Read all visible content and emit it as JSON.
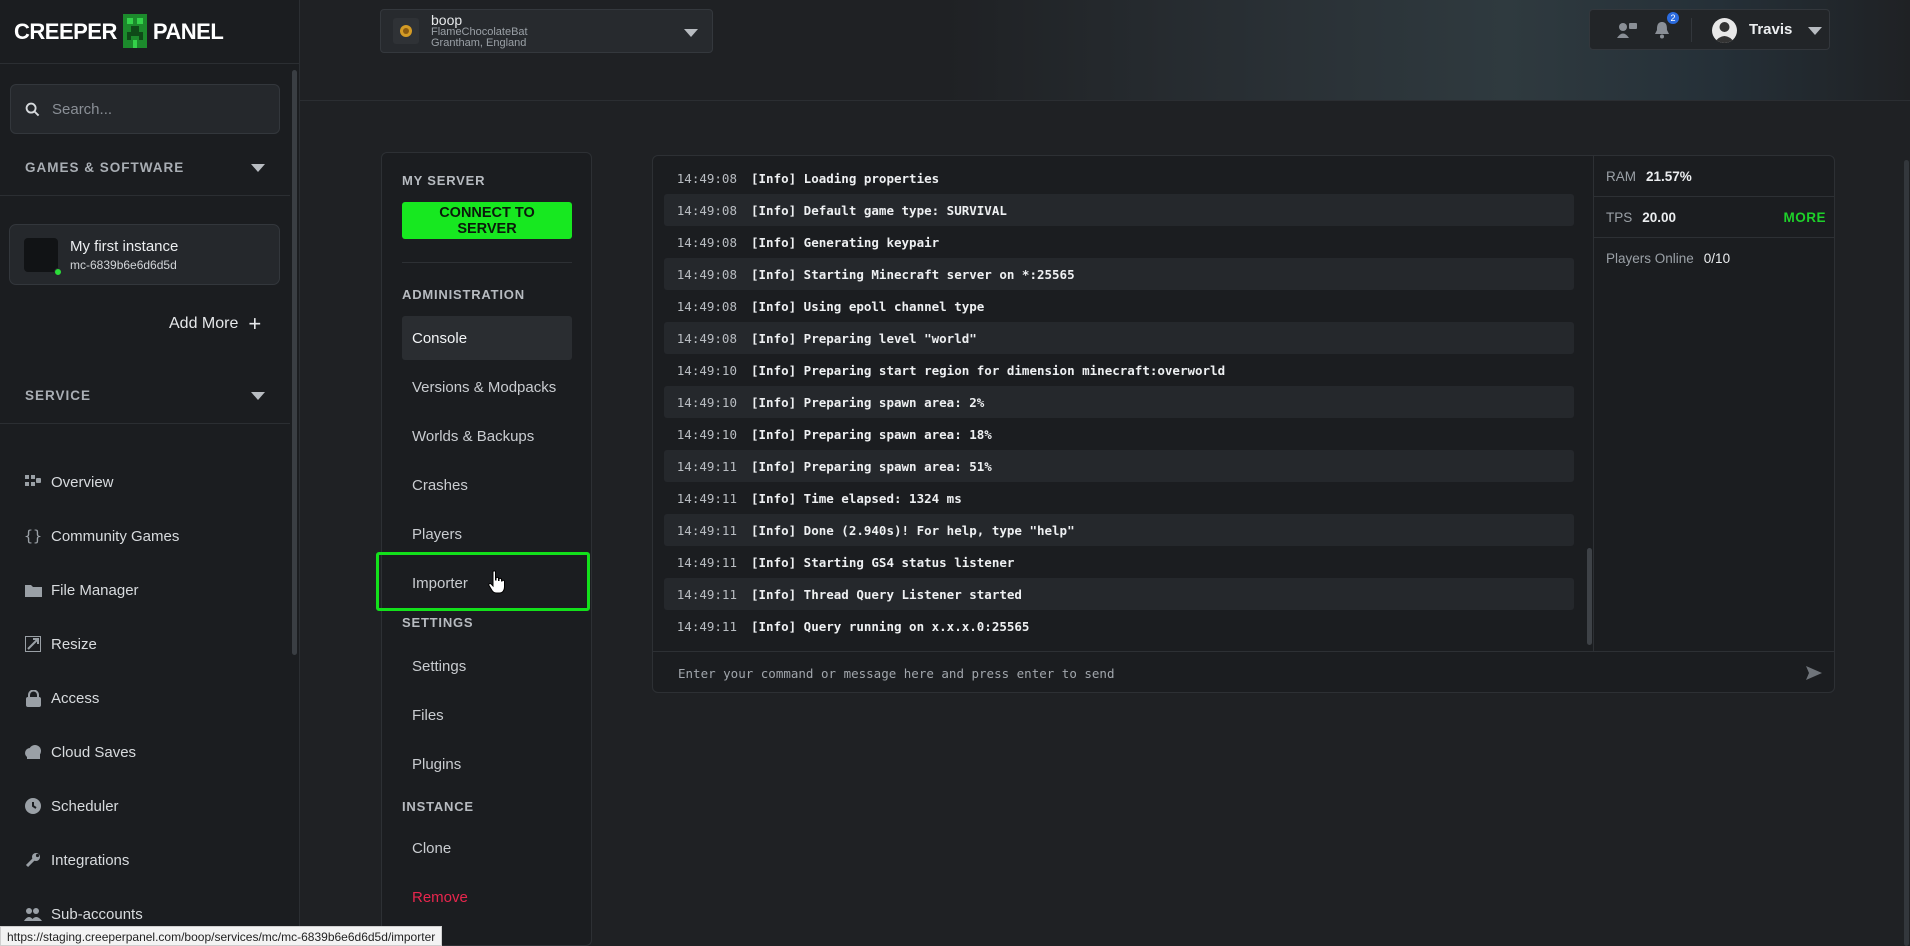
{
  "app": {
    "logo_left": "CREEPER",
    "logo_right": "PANEL",
    "search_placeholder": "Search..."
  },
  "sidebar": {
    "games_section": "GAMES & SOFTWARE",
    "instance": {
      "name": "My first instance",
      "id": "mc-6839b6e6d6d5d",
      "status": "online"
    },
    "add_more": "Add More",
    "service_section": "SERVICE",
    "items": [
      {
        "label": "Overview",
        "icon": "grid-icon"
      },
      {
        "label": "Community Games",
        "icon": "braces-icon"
      },
      {
        "label": "File Manager",
        "icon": "folder-icon"
      },
      {
        "label": "Resize",
        "icon": "resize-icon"
      },
      {
        "label": "Access",
        "icon": "lock-icon"
      },
      {
        "label": "Cloud Saves",
        "icon": "cloud-icon"
      },
      {
        "label": "Scheduler",
        "icon": "clock-icon"
      },
      {
        "label": "Integrations",
        "icon": "wrench-icon"
      },
      {
        "label": "Sub-accounts",
        "icon": "users-icon"
      }
    ]
  },
  "topbar": {
    "server_name": "boop",
    "server_user": "FlameChocolateBat",
    "server_location": "Grantham, England",
    "notifications_count": "2",
    "user_name": "Travis"
  },
  "menu": {
    "my_server": "MY SERVER",
    "connect": "CONNECT TO SERVER",
    "administration": "ADMINISTRATION",
    "admin_items": [
      "Console",
      "Versions & Modpacks",
      "Worlds & Backups",
      "Crashes",
      "Players",
      "Importer"
    ],
    "settings_section": "SETTINGS",
    "settings_items": [
      "Settings",
      "Files",
      "Plugins"
    ],
    "instance_section": "INSTANCE",
    "instance_items": [
      "Clone",
      "Remove"
    ],
    "active": "Console",
    "hovered": "Importer"
  },
  "console": {
    "log": [
      {
        "time": "14:49:08",
        "msg": "[Info] Loading properties"
      },
      {
        "time": "14:49:08",
        "msg": "[Info] Default game type: SURVIVAL"
      },
      {
        "time": "14:49:08",
        "msg": "[Info] Generating keypair"
      },
      {
        "time": "14:49:08",
        "msg": "[Info] Starting Minecraft server on *:25565"
      },
      {
        "time": "14:49:08",
        "msg": "[Info] Using epoll channel type"
      },
      {
        "time": "14:49:08",
        "msg": "[Info] Preparing level \"world\""
      },
      {
        "time": "14:49:10",
        "msg": "[Info] Preparing start region for dimension minecraft:overworld"
      },
      {
        "time": "14:49:10",
        "msg": "[Info] Preparing spawn area: 2%"
      },
      {
        "time": "14:49:10",
        "msg": "[Info] Preparing spawn area: 18%"
      },
      {
        "time": "14:49:11",
        "msg": "[Info] Preparing spawn area: 51%"
      },
      {
        "time": "14:49:11",
        "msg": "[Info] Time elapsed: 1324 ms"
      },
      {
        "time": "14:49:11",
        "msg": "[Info] Done (2.940s)! For help, type \"help\""
      },
      {
        "time": "14:49:11",
        "msg": "[Info] Starting GS4 status listener"
      },
      {
        "time": "14:49:11",
        "msg": "[Info] Thread Query Listener started"
      },
      {
        "time": "14:49:11",
        "msg": "[Info] Query running on x.x.x.0:25565"
      }
    ],
    "command_placeholder": "Enter your command or message here and press enter to send"
  },
  "stats": {
    "ram_label": "RAM",
    "ram_value": "21.57%",
    "tps_label": "TPS",
    "tps_value": "20.00",
    "more": "MORE",
    "players_label": "Players Online",
    "players_value": "0/10"
  },
  "status_url": "https://staging.creeperpanel.com/boop/services/mc/mc-6839b6e6d6d5d/importer",
  "colors": {
    "accent": "#17e820",
    "danger": "#e8264d",
    "badge": "#2b6bde"
  }
}
